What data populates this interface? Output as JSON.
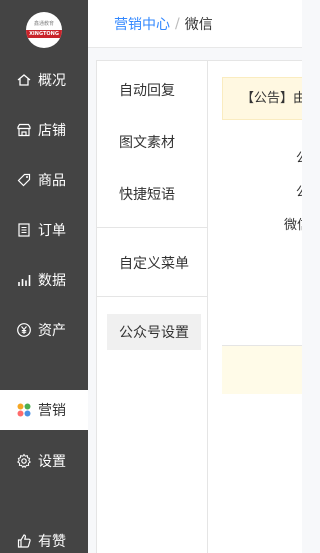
{
  "logo": {
    "top_text": "鑫通教育",
    "band_text": "XINGTONG"
  },
  "sidebar": {
    "items": [
      {
        "label": "概况",
        "icon": "overview-icon"
      },
      {
        "label": "店铺",
        "icon": "shop-icon"
      },
      {
        "label": "商品",
        "icon": "tag-icon"
      },
      {
        "label": "订单",
        "icon": "order-icon"
      },
      {
        "label": "数据",
        "icon": "chart-icon"
      },
      {
        "label": "资产",
        "icon": "yuan-icon"
      },
      {
        "label": "营销",
        "icon": "marketing-icon",
        "active": true
      },
      {
        "label": "设置",
        "icon": "gear-icon"
      },
      {
        "label": "有赞",
        "icon": "thumb-up-icon"
      }
    ]
  },
  "breadcrumb": {
    "parent": "营销中心",
    "separator": "/",
    "current": "微信"
  },
  "submenu": {
    "items": [
      {
        "label": "自动回复"
      },
      {
        "label": "图文素材"
      },
      {
        "label": "快捷短语"
      },
      {
        "label": "自定义菜单"
      },
      {
        "label": "公众号设置",
        "active": true
      }
    ]
  },
  "main": {
    "notice": "【公告】由于",
    "rows": [
      "公",
      "公",
      "微信"
    ]
  },
  "colors": {
    "sidebar_bg": "#444444",
    "link_blue": "#3388ff",
    "notice_bg": "#fff8e1"
  }
}
